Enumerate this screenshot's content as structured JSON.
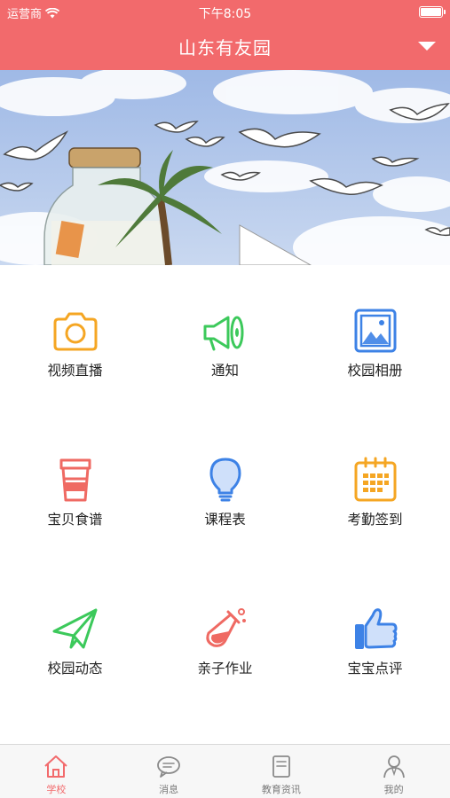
{
  "status_bar": {
    "carrier": "运营商",
    "time": "下午8:05"
  },
  "header": {
    "title": "山东有友园",
    "dropdown_icon": "triangle-down-icon"
  },
  "banner": {
    "description_icon": "banner-illustration"
  },
  "features": [
    {
      "label": "视频直播",
      "icon": "camera-icon",
      "color": "#f5a623"
    },
    {
      "label": "通知",
      "icon": "megaphone-icon",
      "color": "#3cc95b"
    },
    {
      "label": "校园相册",
      "icon": "photo-icon",
      "color": "#3d82e6"
    },
    {
      "label": "宝贝食谱",
      "icon": "cup-icon",
      "color": "#ef6a63"
    },
    {
      "label": "课程表",
      "icon": "bulb-icon",
      "color": "#3d82e6"
    },
    {
      "label": "考勤签到",
      "icon": "calendar-icon",
      "color": "#f5a623"
    },
    {
      "label": "校园动态",
      "icon": "paper-plane-icon",
      "color": "#3cc95b"
    },
    {
      "label": "亲子作业",
      "icon": "flask-icon",
      "color": "#ef6a63"
    },
    {
      "label": "宝宝点评",
      "icon": "thumbs-up-icon",
      "color": "#3d82e6"
    }
  ],
  "tabs": [
    {
      "label": "学校",
      "icon": "home-icon",
      "active": true
    },
    {
      "label": "消息",
      "icon": "chat-icon",
      "active": false
    },
    {
      "label": "教育资讯",
      "icon": "news-icon",
      "active": false
    },
    {
      "label": "我的",
      "icon": "user-icon",
      "active": false
    }
  ],
  "colors": {
    "accent": "#f26a6c",
    "tab_inactive": "#7a7a7a"
  }
}
